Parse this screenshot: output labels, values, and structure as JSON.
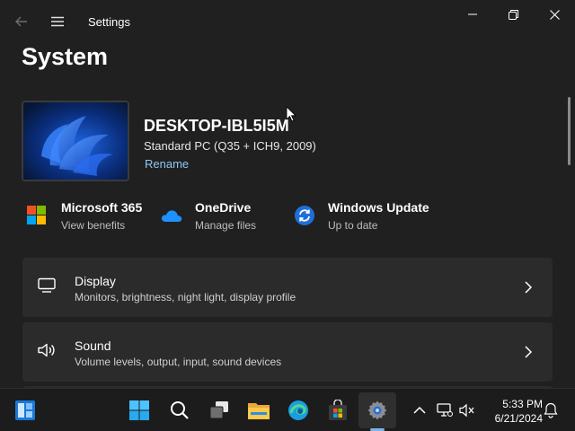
{
  "window": {
    "title": "Settings"
  },
  "page": {
    "title": "System"
  },
  "device": {
    "name": "DESKTOP-IBL5I5M",
    "description": "Standard PC (Q35 + ICH9, 2009)",
    "rename_label": "Rename"
  },
  "quick_links": [
    {
      "title": "Microsoft 365",
      "subtitle": "View benefits",
      "icon": "microsoft-365-icon"
    },
    {
      "title": "OneDrive",
      "subtitle": "Manage files",
      "icon": "onedrive-icon"
    },
    {
      "title": "Windows Update",
      "subtitle": "Up to date",
      "icon": "windows-update-icon"
    }
  ],
  "settings": [
    {
      "title": "Display",
      "description": "Monitors, brightness, night light, display profile",
      "icon": "monitor-icon"
    },
    {
      "title": "Sound",
      "description": "Volume levels, output, input, sound devices",
      "icon": "speaker-icon"
    }
  ],
  "taskbar": {
    "apps": [
      "widgets-icon",
      "start-icon",
      "search-icon",
      "task-view-icon",
      "file-explorer-icon",
      "edge-icon",
      "store-icon",
      "settings-gear-icon"
    ],
    "active_app": "settings-gear-icon",
    "tray": [
      "chevron-up-icon",
      "network-icon",
      "volume-muted-icon",
      "notification-icon"
    ],
    "time": "5:33 PM",
    "date": "6/21/2024"
  },
  "colors": {
    "background": "#202020",
    "card": "#2b2b2b",
    "accent_link": "#8fc6f3",
    "taskbar": "#1c1c1c"
  }
}
